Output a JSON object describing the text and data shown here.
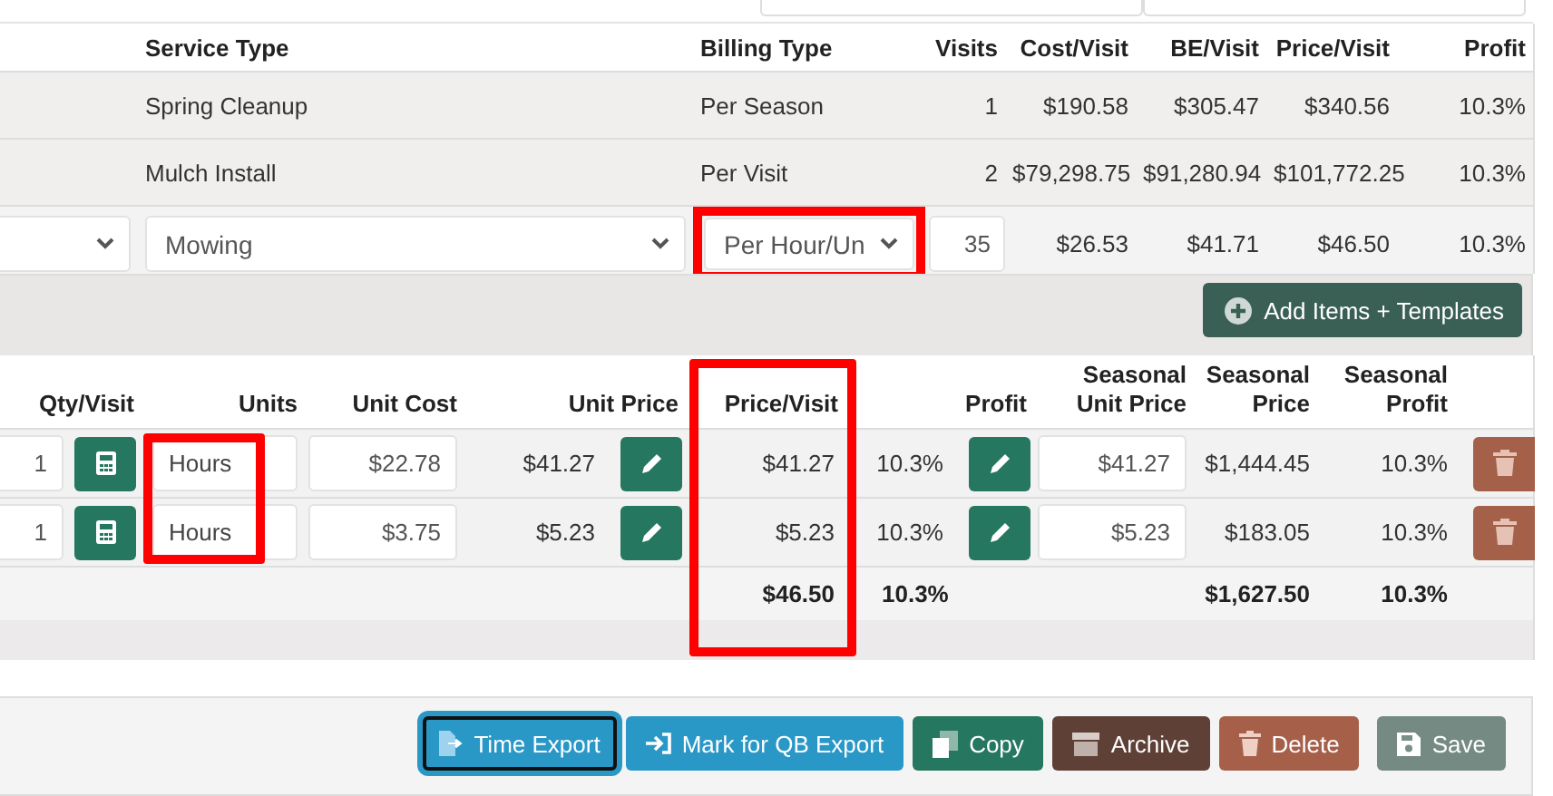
{
  "service_table": {
    "columns": [
      {},
      {
        "label": "Service Type"
      },
      {
        "label": "Billing Type"
      },
      {
        "label": "Visits"
      },
      {
        "label": "Cost/Visit"
      },
      {
        "label": "BE/Visit"
      },
      {
        "label": "Price/Visit"
      },
      {
        "label": "Profit"
      }
    ],
    "rows": [
      {
        "kind": "text",
        "cells": [
          null,
          "Spring Cleanup",
          "Per Season",
          "1",
          "$190.58",
          "$305.47",
          "$340.56",
          "10.3%"
        ]
      },
      {
        "kind": "text",
        "cells": [
          null,
          "Mulch Install",
          "Per Visit",
          "2",
          "$79,298.75",
          "$91,280.94",
          "$101,772.25",
          "10.3%"
        ]
      },
      {
        "kind": "edit",
        "cells": [
          {
            "kind": "select",
            "highlighted": false
          },
          {
            "kind": "select",
            "value": "Mowing",
            "highlighted": false
          },
          {
            "kind": "select",
            "value": "Per Hour/Un",
            "highlighted": true
          },
          {
            "kind": "input",
            "value": "35",
            "highlighted": false
          },
          {
            "kind": "text",
            "value": "$26.53"
          },
          {
            "kind": "text",
            "value": "$41.71"
          },
          {
            "kind": "text",
            "value": "$46.50"
          },
          {
            "kind": "text",
            "value": "10.3%"
          }
        ]
      }
    ]
  },
  "add_button": {
    "label": "Add Items + Templates"
  },
  "item_table": {
    "columns": [
      {
        "label": "Qty/Visit",
        "kind": "input-calc",
        "highlighted": false
      },
      {
        "label": "Units",
        "kind": "input-left",
        "highlighted": true
      },
      {
        "label": "Unit Cost",
        "kind": "input",
        "highlighted": false
      },
      {
        "label": "Unit Price",
        "kind": "text-edit",
        "highlighted": false
      },
      {
        "label": "Price/Visit",
        "kind": "text",
        "highlighted": true,
        "total": "$46.50"
      },
      {
        "label": "Profit",
        "kind": "text-edit",
        "highlighted": false,
        "total": "10.3%"
      },
      {
        "label": "Seasonal Unit Price",
        "kind": "input",
        "highlighted": false
      },
      {
        "label": "Seasonal Price",
        "kind": "text",
        "highlighted": false,
        "total": "$1,627.50"
      },
      {
        "label": "Seasonal Profit",
        "kind": "text",
        "highlighted": false,
        "total": "10.3%"
      },
      {
        "kind": "delete"
      }
    ],
    "rows": [
      [
        "1",
        "Hours",
        "$22.78",
        "$41.27",
        "$41.27",
        "10.3%",
        "$41.27",
        "$1,444.45",
        "10.3%"
      ],
      [
        "1",
        "Hours",
        "$3.75",
        "$5.23",
        "$5.23",
        "10.3%",
        "$5.23",
        "$183.05",
        "10.3%"
      ]
    ]
  },
  "actions": [
    {
      "label": "Time Export",
      "kind": "info",
      "focused": true
    },
    {
      "label": "Mark for QB Export",
      "kind": "info",
      "focused": false
    },
    {
      "label": "Copy",
      "kind": "success",
      "focused": false
    },
    {
      "label": "Archive",
      "kind": "dark",
      "focused": false
    },
    {
      "label": "Delete",
      "kind": "danger",
      "focused": false
    },
    {
      "label": "Save",
      "kind": "muted",
      "focused": false
    }
  ]
}
